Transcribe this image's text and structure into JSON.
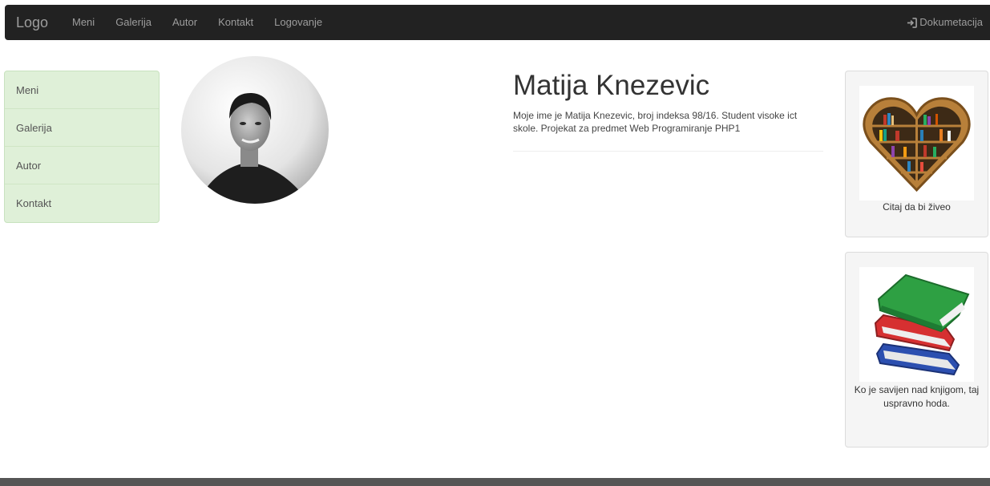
{
  "navbar": {
    "brand": "Logo",
    "links": [
      "Meni",
      "Galerija",
      "Autor",
      "Kontakt",
      "Logovanje"
    ],
    "right_link": "Dokumetacija",
    "right_icon": "login-icon"
  },
  "sidebar": {
    "items": [
      "Meni",
      "Galerija",
      "Autor",
      "Kontakt"
    ]
  },
  "profile": {
    "name": "Matija Knezevic",
    "description": "Moje ime je Matija Knezevic, broj indeksa 98/16. Student visoke ict skole. Projekat za predmet Web Programiranje PHP1"
  },
  "cards": [
    {
      "caption": "Citaj da bi živeo",
      "image": "heart-bookshelf"
    },
    {
      "caption": "Ko je savijen nad knjigom, taj uspravno hoda.",
      "image": "book-stack"
    }
  ],
  "colors": {
    "navbar_bg": "#222222",
    "nav_text": "#9d9d9d",
    "sidebar_bg": "#dff0d8",
    "card_bg": "#f5f5f5",
    "footer_bg": "#555555"
  }
}
